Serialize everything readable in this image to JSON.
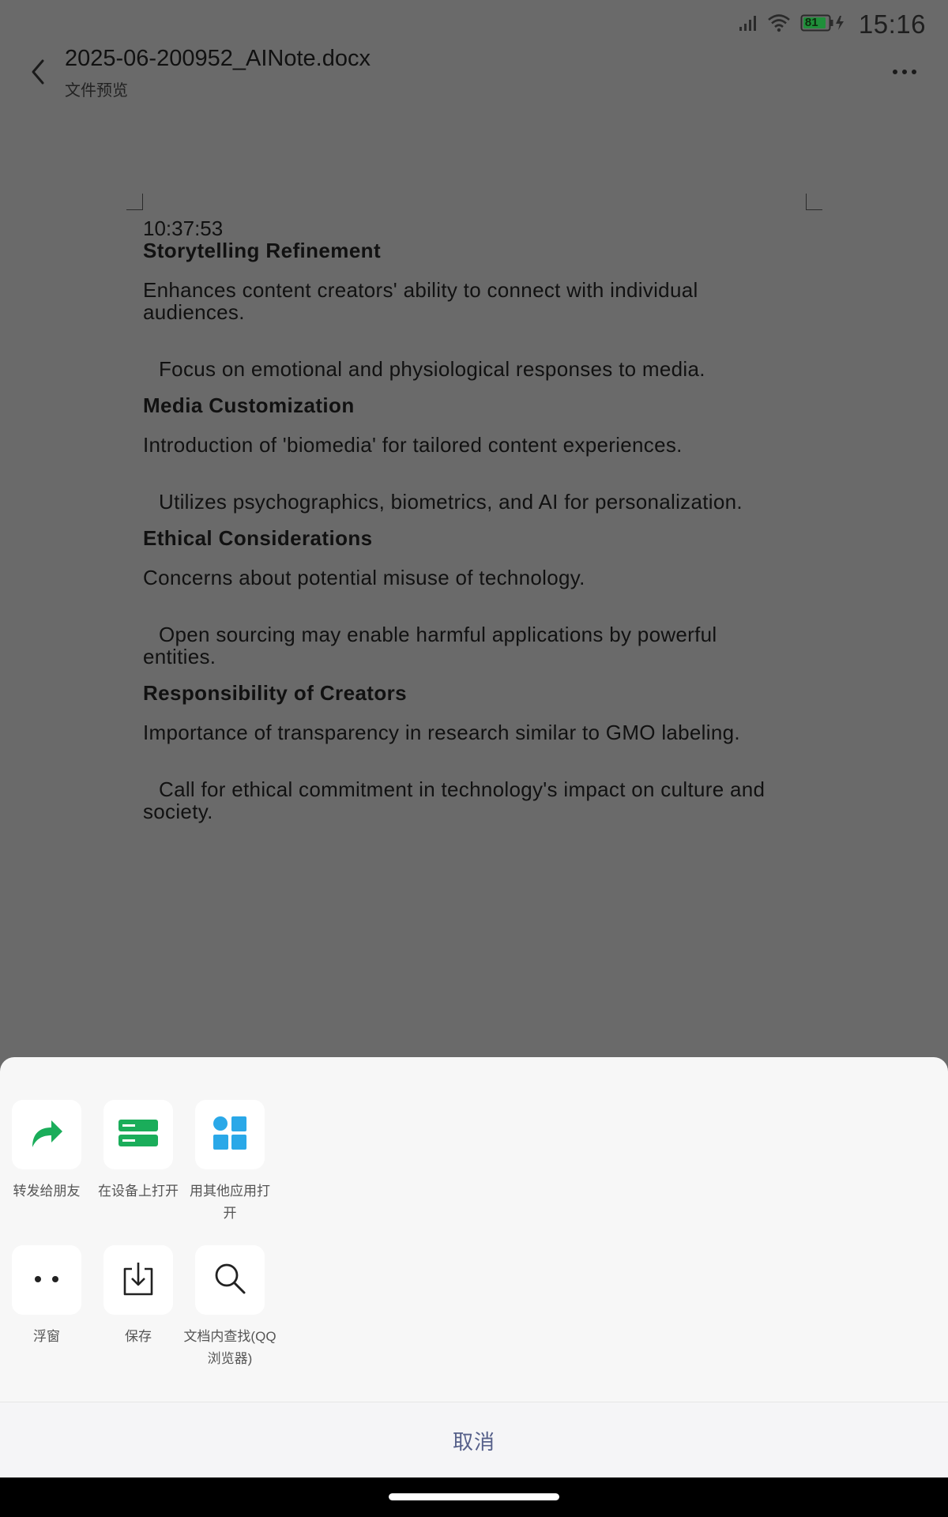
{
  "status_bar": {
    "battery_level": "81",
    "time": "15:16"
  },
  "header": {
    "title": "2025-06-200952_AINote.docx",
    "subtitle": "文件预览"
  },
  "document": {
    "timestamp": "10:37:53",
    "sections": [
      {
        "heading": "Storytelling Refinement",
        "paragraph": "Enhances content creators' ability to connect with individual audiences.",
        "sub": "Focus on emotional and physiological responses to media."
      },
      {
        "heading": "Media Customization",
        "paragraph": "Introduction of 'biomedia' for tailored content experiences.",
        "sub": "Utilizes psychographics, biometrics, and AI for personalization."
      },
      {
        "heading": "Ethical Considerations",
        "paragraph": "Concerns about potential misuse of technology.",
        "sub": "Open sourcing may enable harmful applications by powerful entities."
      },
      {
        "heading": "Responsibility of Creators",
        "paragraph": "Importance of transparency in research similar to GMO labeling.",
        "sub": "Call for ethical commitment in technology's impact on culture and society."
      }
    ]
  },
  "sheet": {
    "actions": [
      {
        "label": "转发给朋友",
        "icon": "forward-icon"
      },
      {
        "label": "在设备上打开",
        "icon": "device-open-icon"
      },
      {
        "label": "用其他应用打开",
        "icon": "other-apps-icon"
      },
      {
        "label": "浮窗",
        "icon": "float-window-icon"
      },
      {
        "label": "保存",
        "icon": "save-icon"
      },
      {
        "label": "文档内查找(QQ浏览器)",
        "icon": "search-icon"
      }
    ],
    "cancel_label": "取消"
  },
  "colors": {
    "accent_green": "#1aad5a",
    "accent_blue": "#2aa8e8",
    "cancel_text": "#56608a"
  }
}
